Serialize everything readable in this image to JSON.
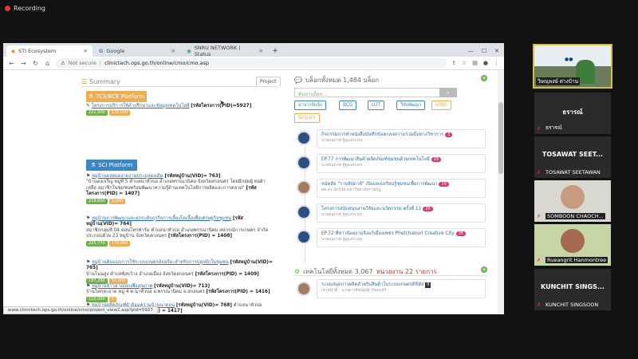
{
  "recording": {
    "label": "Recording"
  },
  "browser": {
    "tabs": [
      {
        "label": "STI Ecosystem"
      },
      {
        "label": "Google"
      },
      {
        "label": "SNRU NETWORK | Status"
      }
    ],
    "not_secure": "Not secure",
    "url": "clinictech.ops.go.th/online/cmo/cmo.asp"
  },
  "left": {
    "summary_title": "Summary",
    "project_tab": "Project",
    "tcs_button": "TCS/BCE Platform",
    "tcs_item": {
      "link": "โครงการบริการให้คำปรึกษาและข้อมูลเทคโนโลยี",
      "code": "[รหัสโครงการ(PID)=5927]",
      "b1": "222,500",
      "b2": "120,000"
    },
    "sci_button": "SCI Platform",
    "items": [
      {
        "title": "หมู่บ้านดงหมดงามงามประดุจดงเดิม",
        "vid": "[รหัสหมู่บ้าน(VID)= 763]",
        "desc": "\"บ้านดงเจริญ หมู่ที่ 5 ตำบลนาหัวบ่อ อำเภอพรรณานิคม จังหวัดสกลนคร โดยมีกลุ่มผู้ ทอผ้าเหลือ สมาชิกในชุมชนพร้อมพัฒนาความรู้ด้านเทคโนโลยีการผลิตและการตลาด\"",
        "pid": "[รหัสโครงการ(PID) = 1407]",
        "b1": "218,800",
        "b2": "3,000"
      },
      {
        "title": "หมู่บ้านการพัฒนาและยกระดับธุรกิจการเลี้ยงโคเนื้อเพื่อเศรษฐกิจชุมชน",
        "vid": "[รหัสหมู่บ้าน(VID)= 764]",
        "desc": "สมาชิกกลุ่มที่ 04 คอนโทรฟาร์ม ตำบลนาหัวบ่อ อำเภอพรรณานิคม สหกรณ์การเกษตร จำกัด ประกอบด้วย 23 หมู่บ้าน จังหวัดสกลนคร",
        "pid": "[รหัสโครงการ(PID) = 1408]",
        "b1": "225,770",
        "b2": "170,000"
      },
      {
        "title": "หมู่บ้านต้นแบบการใช้ระบบเกษตรอัจฉริยะสำหรับการปลูกผักในชุมชน",
        "vid": "[รหัสหมู่บ้าน(VID)= 765]",
        "desc": "บ้านโนนสูง ตำบลพังขว้าง อำเภอเมือง จังหวัดสกลนคร",
        "pid": "[รหัสโครงการ(PID) = 1409]",
        "b1": "187,280",
        "b2": "50,000"
      },
      {
        "title": "หมู่บ้านข้าวฮางงอกเพื่อสุขภาพ",
        "vid": "[รหัสหมู่บ้าน(VID)= 713]",
        "desc": "บ้านโคกสะอาด หมู่ 4 ต.นาหัวบ่อ อ.พรรณานิคม จ.สกลนคร",
        "pid": "[รหัสโครงการ(PID) = 1416]",
        "b1": "110,000",
        "b2": "0"
      },
      {
        "title": "หมู่บ้านผลิตภัณฑ์ผ้าย้อมครามบ้านนาดอน",
        "vid": "[รหัสหมู่บ้าน(VID)= 768]",
        "desc": "ตำบลนาหัวบ่อ จังหวัดสกลนคร",
        "pid": "[รหัสโครงการ(PID) = 1417]"
      }
    ]
  },
  "right": {
    "blog_title": "บล็อกทั้งหมด 1,484 บล็อก",
    "search_placeholder": "ค้นหาบล็อก...",
    "chips": [
      "อาจารย์แจ้ง",
      "BCG",
      "U2T",
      "วิจัยพัฒนา",
      "คลินิก",
      "Bclpark"
    ],
    "posts": [
      {
        "title": "กิจกรรมการทำหนังสือบันทึกข้อตกลงความร่วมมือทางวิชาการ",
        "count": "3",
        "author": "นายอนุภาพ ผู้ดูแลระบบ"
      },
      {
        "title": "EP.77 การพัฒนาสินค้าผลิตภัณฑ์ชุมชนด้วยเทคโนโลยี",
        "count": "29",
        "author": "นายอนุภาพ ผู้ดูแลระบบ"
      },
      {
        "title": "หมัดดีย \"รายสัปดาห์\" เปิดแหล่งเรียนรู้ชุมชนเพื่อการพัฒนา",
        "count": "16",
        "author": "ผศ.ดร.นักวิจัย มหาวิทยาลัยราชภัฏ"
      },
      {
        "title": "โครงการสนับสนุนงานวิจัยและนวัตกรรม ครั้งที่ 11",
        "count": "20",
        "author": "นายอนุภาพ ผู้ดูแลระบบ"
      },
      {
        "title": "EP.72 ที่ชาวน้อยงามจึงแก้เมืองเพชร Phetchaburi Creative City",
        "count": "35",
        "author": "นายอนุภาพ ผู้ดูแลระบบ"
      }
    ],
    "tech_title": "เทคโนโลยีทั้งหมด 3,067",
    "tech_count": "หน่วยงาน 22 รายการ",
    "tech_post": {
      "title": "ระบบสมุดการผลิตสำหรับสินค้าในระบบเกษตรดิจิทัล",
      "badge": "9",
      "author": "เจ้าหน้าที่ : นางสาวพิชญ์ณัฐ์ ขันทะศรี"
    }
  },
  "status_url": "www.clinictech.ops.go.th/online/cmo/project_view2.asp?pid=5927",
  "participants": [
    {
      "name": "วิษณุพงษ์ ต่างบ้าน"
    },
    {
      "display": "ธรารณ์",
      "name": "ธรารณ์"
    },
    {
      "display": "TOSAWAT SEET...",
      "name": "TOSAWAT SEETAWAN"
    },
    {
      "name": "SOMBOON CHAOCH..."
    },
    {
      "name": "Rueangrit Hanmontree"
    },
    {
      "display": "KUNCHIT SINGS...",
      "name": "KUNCHIT SINGSOON"
    }
  ]
}
